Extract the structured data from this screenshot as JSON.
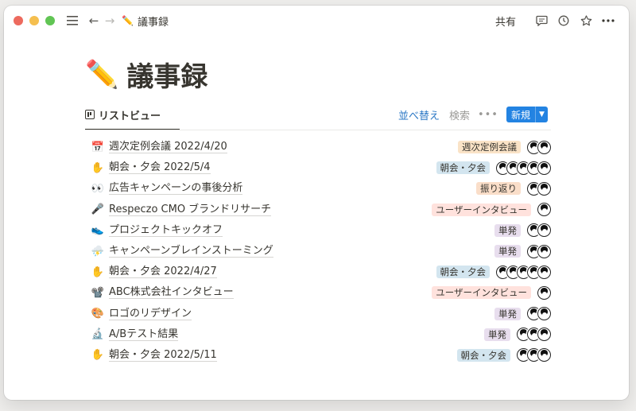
{
  "breadcrumb": {
    "emoji": "✏️",
    "title": "議事録"
  },
  "toolbar": {
    "share_label": "共有"
  },
  "page": {
    "emoji": "✏️",
    "title": "議事録"
  },
  "view": {
    "tab_label": "リストビュー",
    "sort_label": "並べ替え",
    "search_label": "検索",
    "more_label": "•••",
    "new_label": "新規"
  },
  "colors": {
    "accent": "#2383e2",
    "tag_orange": "#fae3c7",
    "tag_blue": "#d3e5ef",
    "tag_brown": "#fadec9",
    "tag_pink": "#ffe2dd",
    "tag_purple": "#e8deee"
  },
  "rows": [
    {
      "emoji": "📅",
      "title": "週次定例会議 2022/4/20",
      "tag": "週次定例会議",
      "tag_color": "#fae3c7",
      "avatars": 2
    },
    {
      "emoji": "✋",
      "title": "朝会・夕会 2022/5/4",
      "tag": "朝会・夕会",
      "tag_color": "#d3e5ef",
      "avatars": 5
    },
    {
      "emoji": "👀",
      "title": "広告キャンペーンの事後分析",
      "tag": "振り返り",
      "tag_color": "#fadec9",
      "avatars": 2
    },
    {
      "emoji": "🎤",
      "title": "Respeczo CMO ブランドリサーチ",
      "tag": "ユーザーインタビュー",
      "tag_color": "#ffe2dd",
      "avatars": 1
    },
    {
      "emoji": "👟",
      "title": "プロジェクトキックオフ",
      "tag": "単発",
      "tag_color": "#e8deee",
      "avatars": 2
    },
    {
      "emoji": "⛈️",
      "title": "キャンペーンブレインストーミング",
      "tag": "単発",
      "tag_color": "#e8deee",
      "avatars": 2
    },
    {
      "emoji": "✋",
      "title": "朝会・夕会 2022/4/27",
      "tag": "朝会・夕会",
      "tag_color": "#d3e5ef",
      "avatars": 5
    },
    {
      "emoji": "📽️",
      "title": "ABC株式会社インタビュー",
      "tag": "ユーザーインタビュー",
      "tag_color": "#ffe2dd",
      "avatars": 1
    },
    {
      "emoji": "🎨",
      "title": "ロゴのリデザイン",
      "tag": "単発",
      "tag_color": "#e8deee",
      "avatars": 2
    },
    {
      "emoji": "🔬",
      "title": "A/Bテスト結果",
      "tag": "単発",
      "tag_color": "#e8deee",
      "avatars": 3
    },
    {
      "emoji": "✋",
      "title": "朝会・夕会 2022/5/11",
      "tag": "朝会・夕会",
      "tag_color": "#d3e5ef",
      "avatars": 3
    }
  ]
}
